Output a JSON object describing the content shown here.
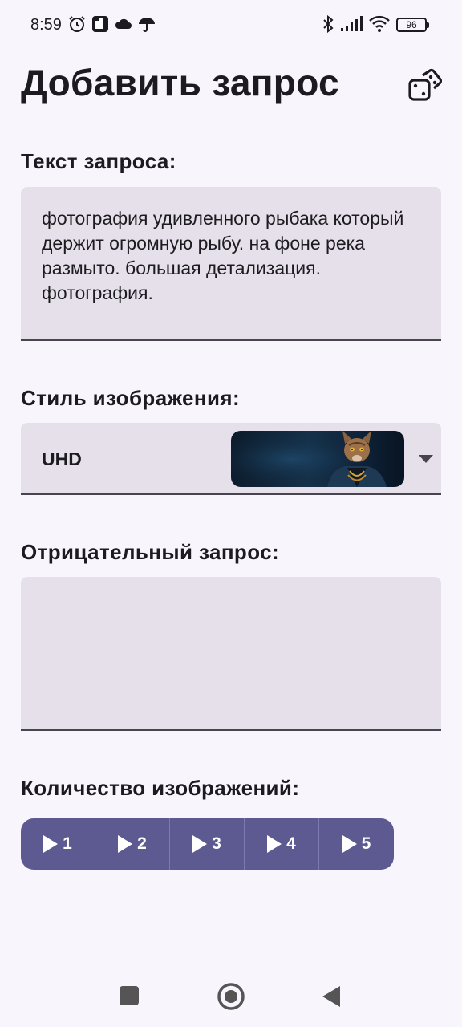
{
  "status_bar": {
    "time": "8:59",
    "battery": "96",
    "left_icons": [
      "alarm-icon",
      "app-notification-icon",
      "cloud-icon",
      "umbrella-icon"
    ],
    "right_icons": [
      "bluetooth-icon",
      "signal-icon",
      "wifi-icon",
      "battery-icon"
    ]
  },
  "header": {
    "title": "Добавить запрос",
    "action_icon": "dice-icon"
  },
  "prompt": {
    "label": "Текст запроса:",
    "value": "фотография удивленного рыбака который держит огромную рыбу. на фоне река размыто. большая детализация. фотография."
  },
  "style": {
    "label": "Стиль изображения:",
    "selected": "UHD",
    "preview_icon": "cat-preview-image"
  },
  "negative": {
    "label": "Отрицательный запрос:",
    "value": ""
  },
  "count": {
    "label": "Количество изображений:",
    "options": [
      "1",
      "2",
      "3",
      "4",
      "5"
    ]
  },
  "colors": {
    "background": "#f8f6fc",
    "field": "#e6e0ea",
    "accent": "#5d5a92"
  }
}
